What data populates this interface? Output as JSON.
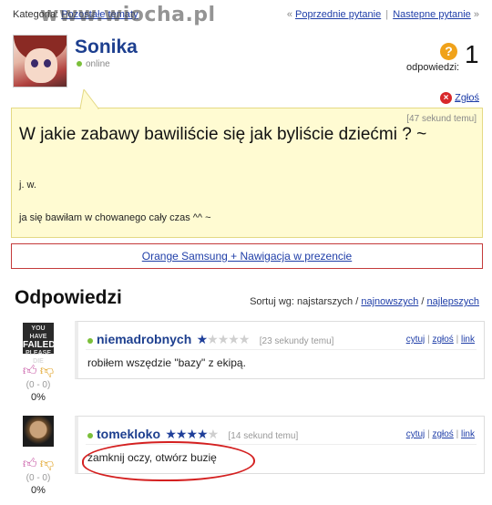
{
  "topbar": {
    "crumb_label": "Kategoria:",
    "crumb_link": "Pozostałe tematy",
    "prev_label": "Poprzednie pytanie",
    "next_label": "Nastepne pytanie",
    "sep": "|",
    "laquo": "«",
    "raquo": "»",
    "watermark": "www.wiocha.pl"
  },
  "author": {
    "name": "Sonika",
    "status": "online"
  },
  "stats": {
    "answers_label": "odpowiedzi:",
    "answers_count": "1"
  },
  "report_label": "Zgłoś",
  "question": {
    "time": "[47 sekund temu]",
    "title": "W jakie zabawy bawiliście się jak byliście dziećmi ? ~",
    "line1": "j. w.",
    "line2": "ja się bawiłam w chowanego cały czas ^^ ~"
  },
  "promo_link": "Orange Samsung + Nawigacja w prezencie",
  "answers_section": {
    "heading": "Odpowiedzi",
    "sort_label": "Sortuj wg: najstarszych /",
    "sort_newest": "najnowszych",
    "sort_slash": "/",
    "sort_best": "najlepszych"
  },
  "answers": [
    {
      "author": "niemadrobnych",
      "rating": 1,
      "time": "[23 sekundy temu]",
      "text": "robiłem wszędzie \"bazy\" z ekipą.",
      "votes": "(0 - 0)",
      "percent": "0%",
      "avatar_text": [
        "YOU HAVE",
        "FAILED",
        "PLEASE DIE"
      ]
    },
    {
      "author": "tomekloko",
      "rating": 3.5,
      "time": "[14 sekund temu]",
      "text": "zamknij oczy, otwórz buzię",
      "votes": "(0 - 0)",
      "percent": "0%"
    }
  ],
  "actions": {
    "quote": "cytuj",
    "report": "zgłoś",
    "link": "link",
    "sep": "|"
  },
  "colors": {
    "link": "#1f3ea8",
    "username": "#1d3f8f",
    "question_bg": "#fffbd2",
    "promo_border": "#c43a3a",
    "scribble": "#d42020"
  }
}
